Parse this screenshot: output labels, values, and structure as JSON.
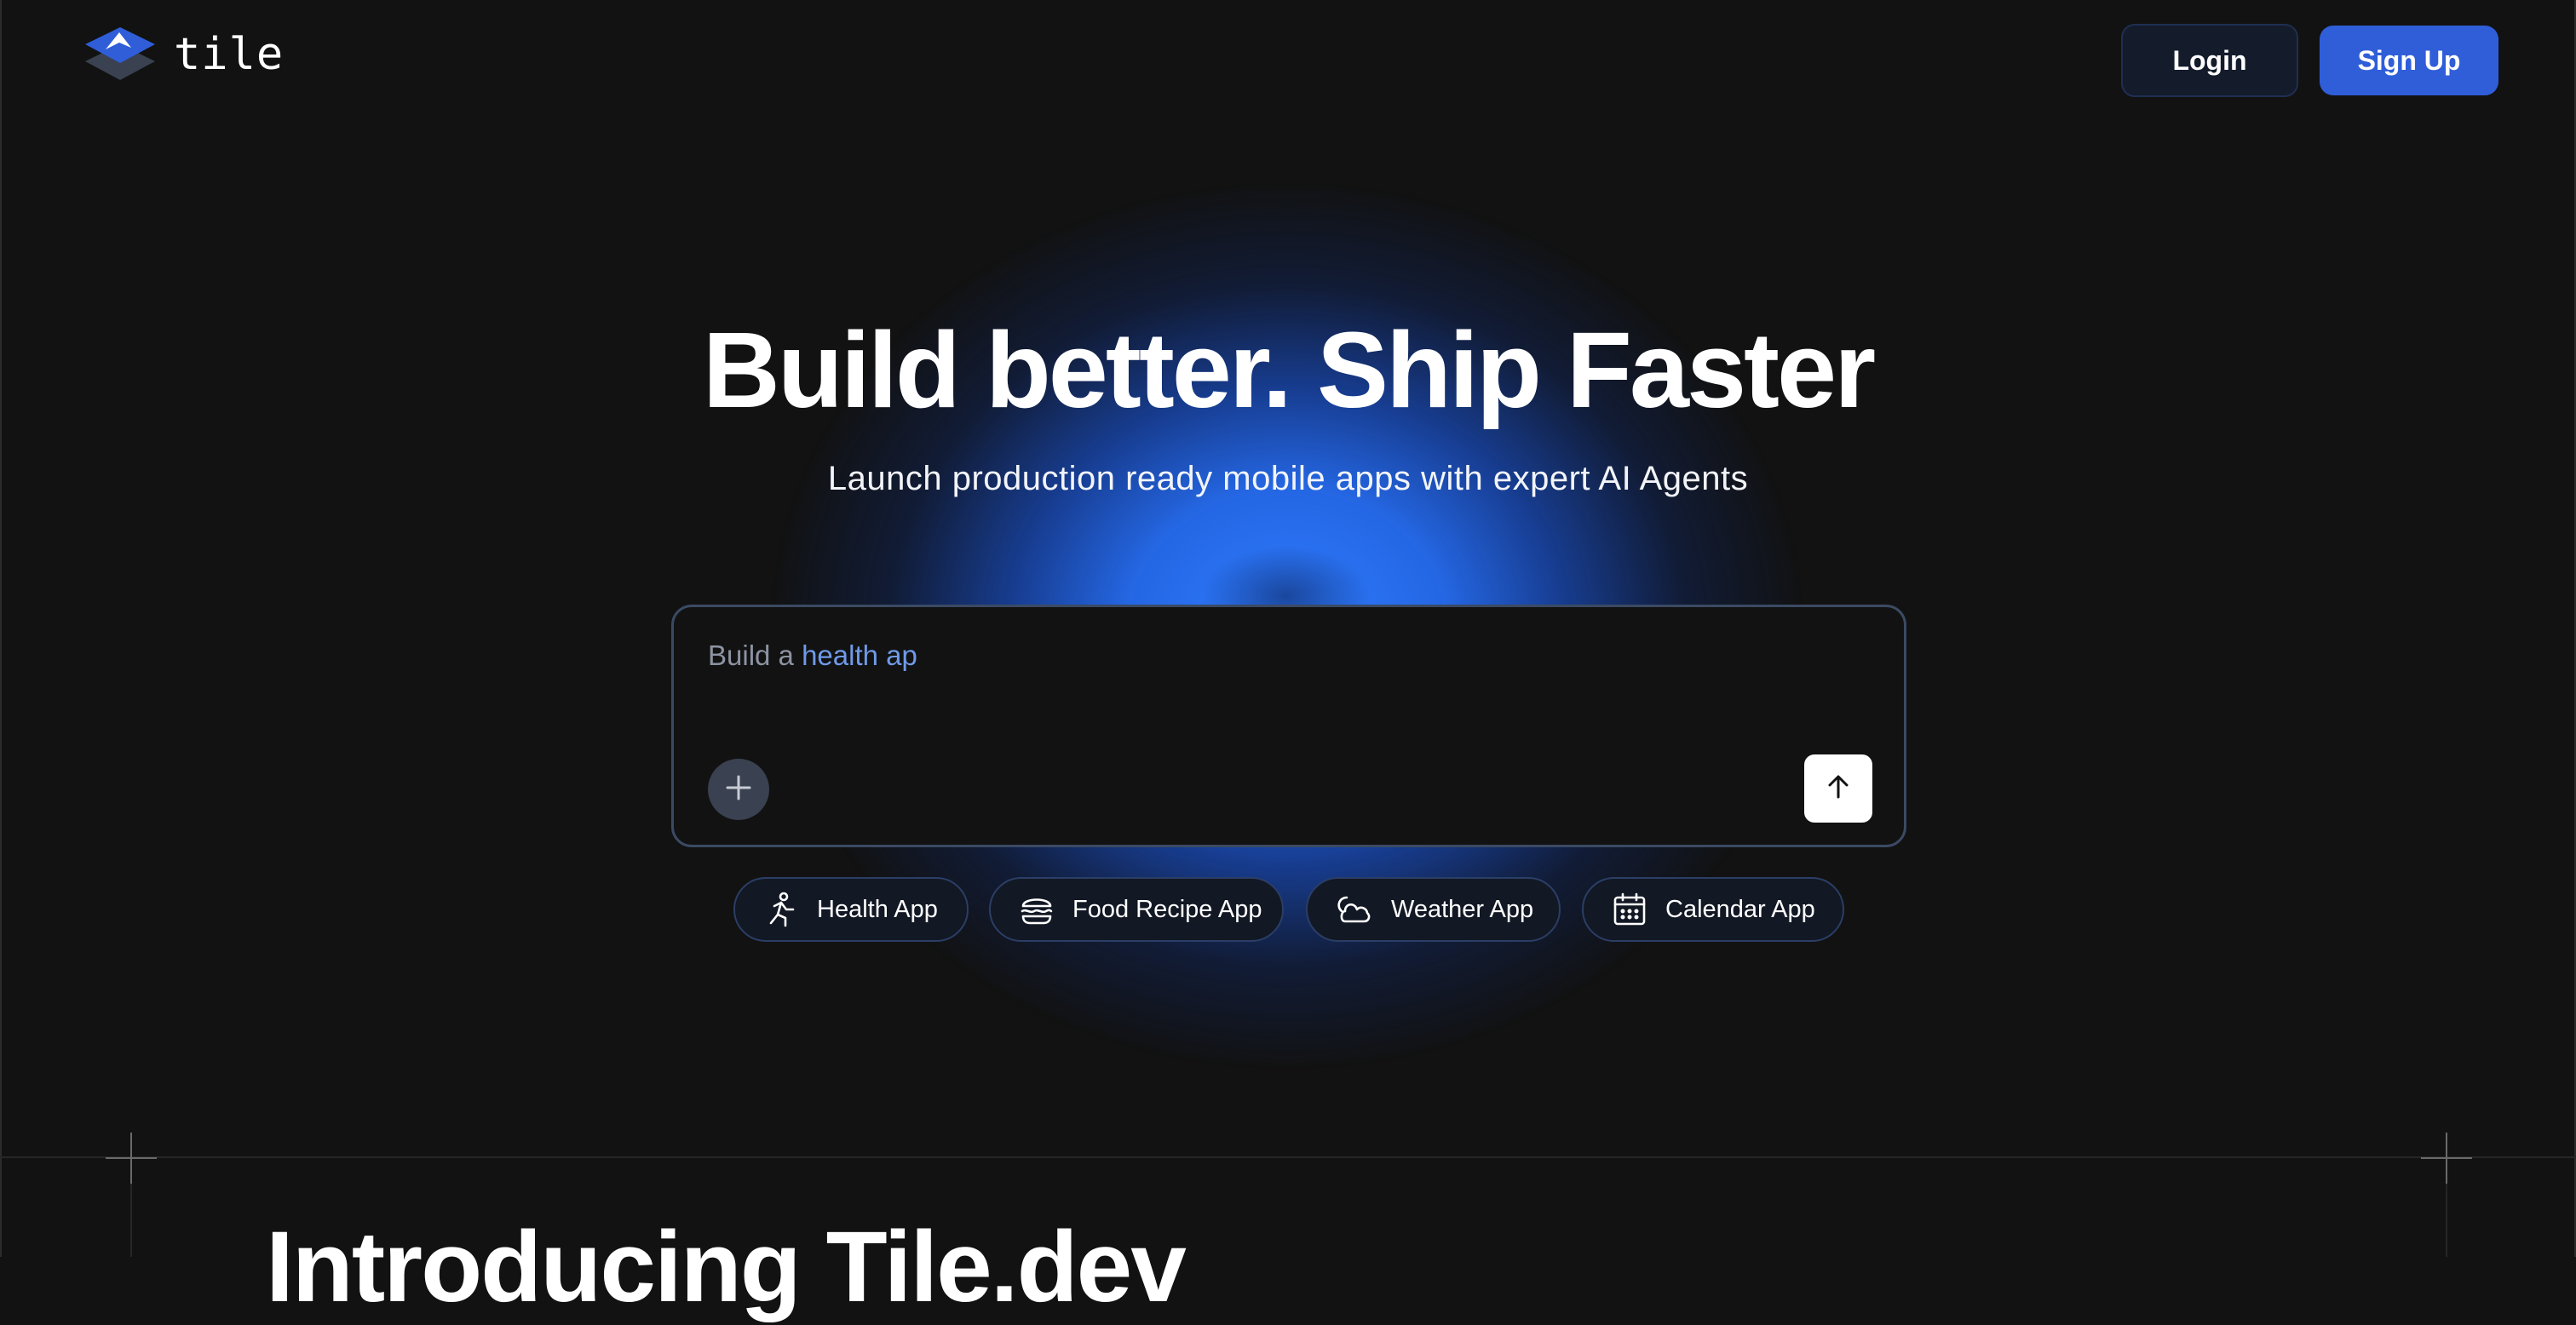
{
  "header": {
    "logo_text": "tile",
    "login_label": "Login",
    "signup_label": "Sign Up"
  },
  "hero": {
    "title": "Build better. Ship Faster",
    "subtitle": "Launch production ready mobile apps with expert AI Agents"
  },
  "prompt": {
    "prefix": "Build a",
    "typed_text": "health ap",
    "attach_icon": "plus-icon",
    "send_icon": "arrow-up-icon"
  },
  "suggestions": [
    {
      "label": "Health App",
      "icon": "running-person-icon"
    },
    {
      "label": "Food Recipe App",
      "icon": "burger-icon"
    },
    {
      "label": "Weather App",
      "icon": "cloud-sun-icon"
    },
    {
      "label": "Calendar App",
      "icon": "calendar-icon"
    }
  ],
  "section": {
    "title": "Introducing Tile.dev"
  },
  "colors": {
    "background": "#121212",
    "accent": "#2f5ed8",
    "glow": "#2f7cff",
    "typed_text": "#6f9ae8"
  }
}
